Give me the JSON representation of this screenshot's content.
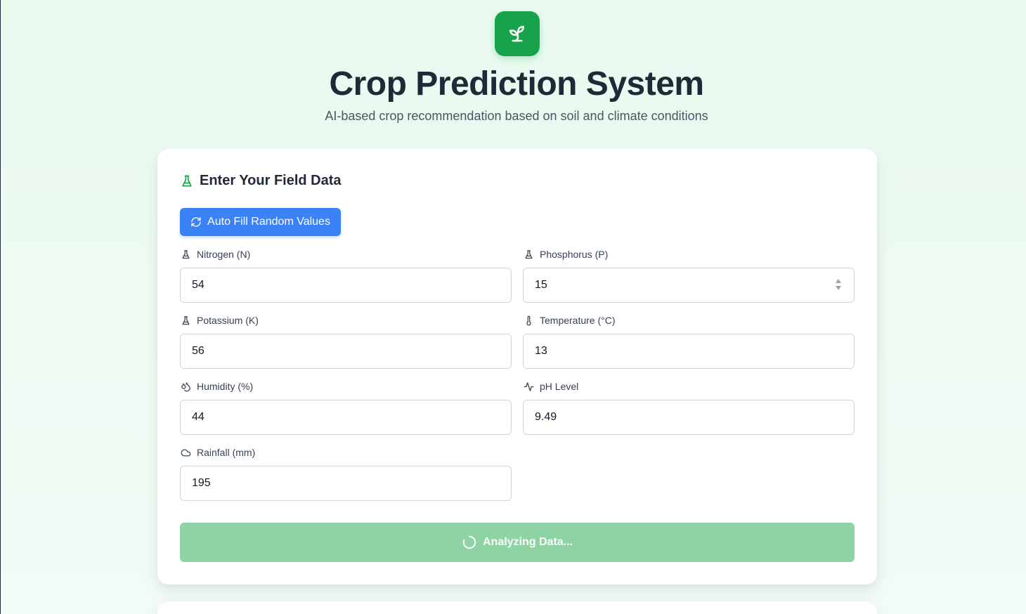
{
  "header": {
    "logo_icon": "sprout-icon",
    "title": "Crop Prediction System",
    "subtitle": "AI-based crop recommendation based on soil and climate conditions",
    "brand_color": "#16a34a"
  },
  "form": {
    "heading": "Enter Your Field Data",
    "heading_icon": "flask-icon",
    "autofill_label": "Auto Fill Random Values",
    "autofill_icon": "refresh-icon",
    "autofill_color": "#3b82f6",
    "fields": {
      "nitrogen": {
        "label": "Nitrogen (N)",
        "value": "54",
        "icon": "flask-icon"
      },
      "phosphorus": {
        "label": "Phosphorus (P)",
        "value": "15",
        "icon": "flask-icon"
      },
      "potassium": {
        "label": "Potassium (K)",
        "value": "56",
        "icon": "flask-icon"
      },
      "temperature": {
        "label": "Temperature (°C)",
        "value": "13",
        "icon": "thermometer-icon"
      },
      "humidity": {
        "label": "Humidity (%)",
        "value": "44",
        "icon": "droplets-icon"
      },
      "ph": {
        "label": "pH Level",
        "value": "9.49",
        "icon": "activity-icon"
      },
      "rainfall": {
        "label": "Rainfall (mm)",
        "value": "195",
        "icon": "cloud-icon"
      }
    },
    "submit_label": "Analyzing Data...",
    "submit_icon": "loading-spinner-icon",
    "submit_color": "#8dd3a4"
  }
}
